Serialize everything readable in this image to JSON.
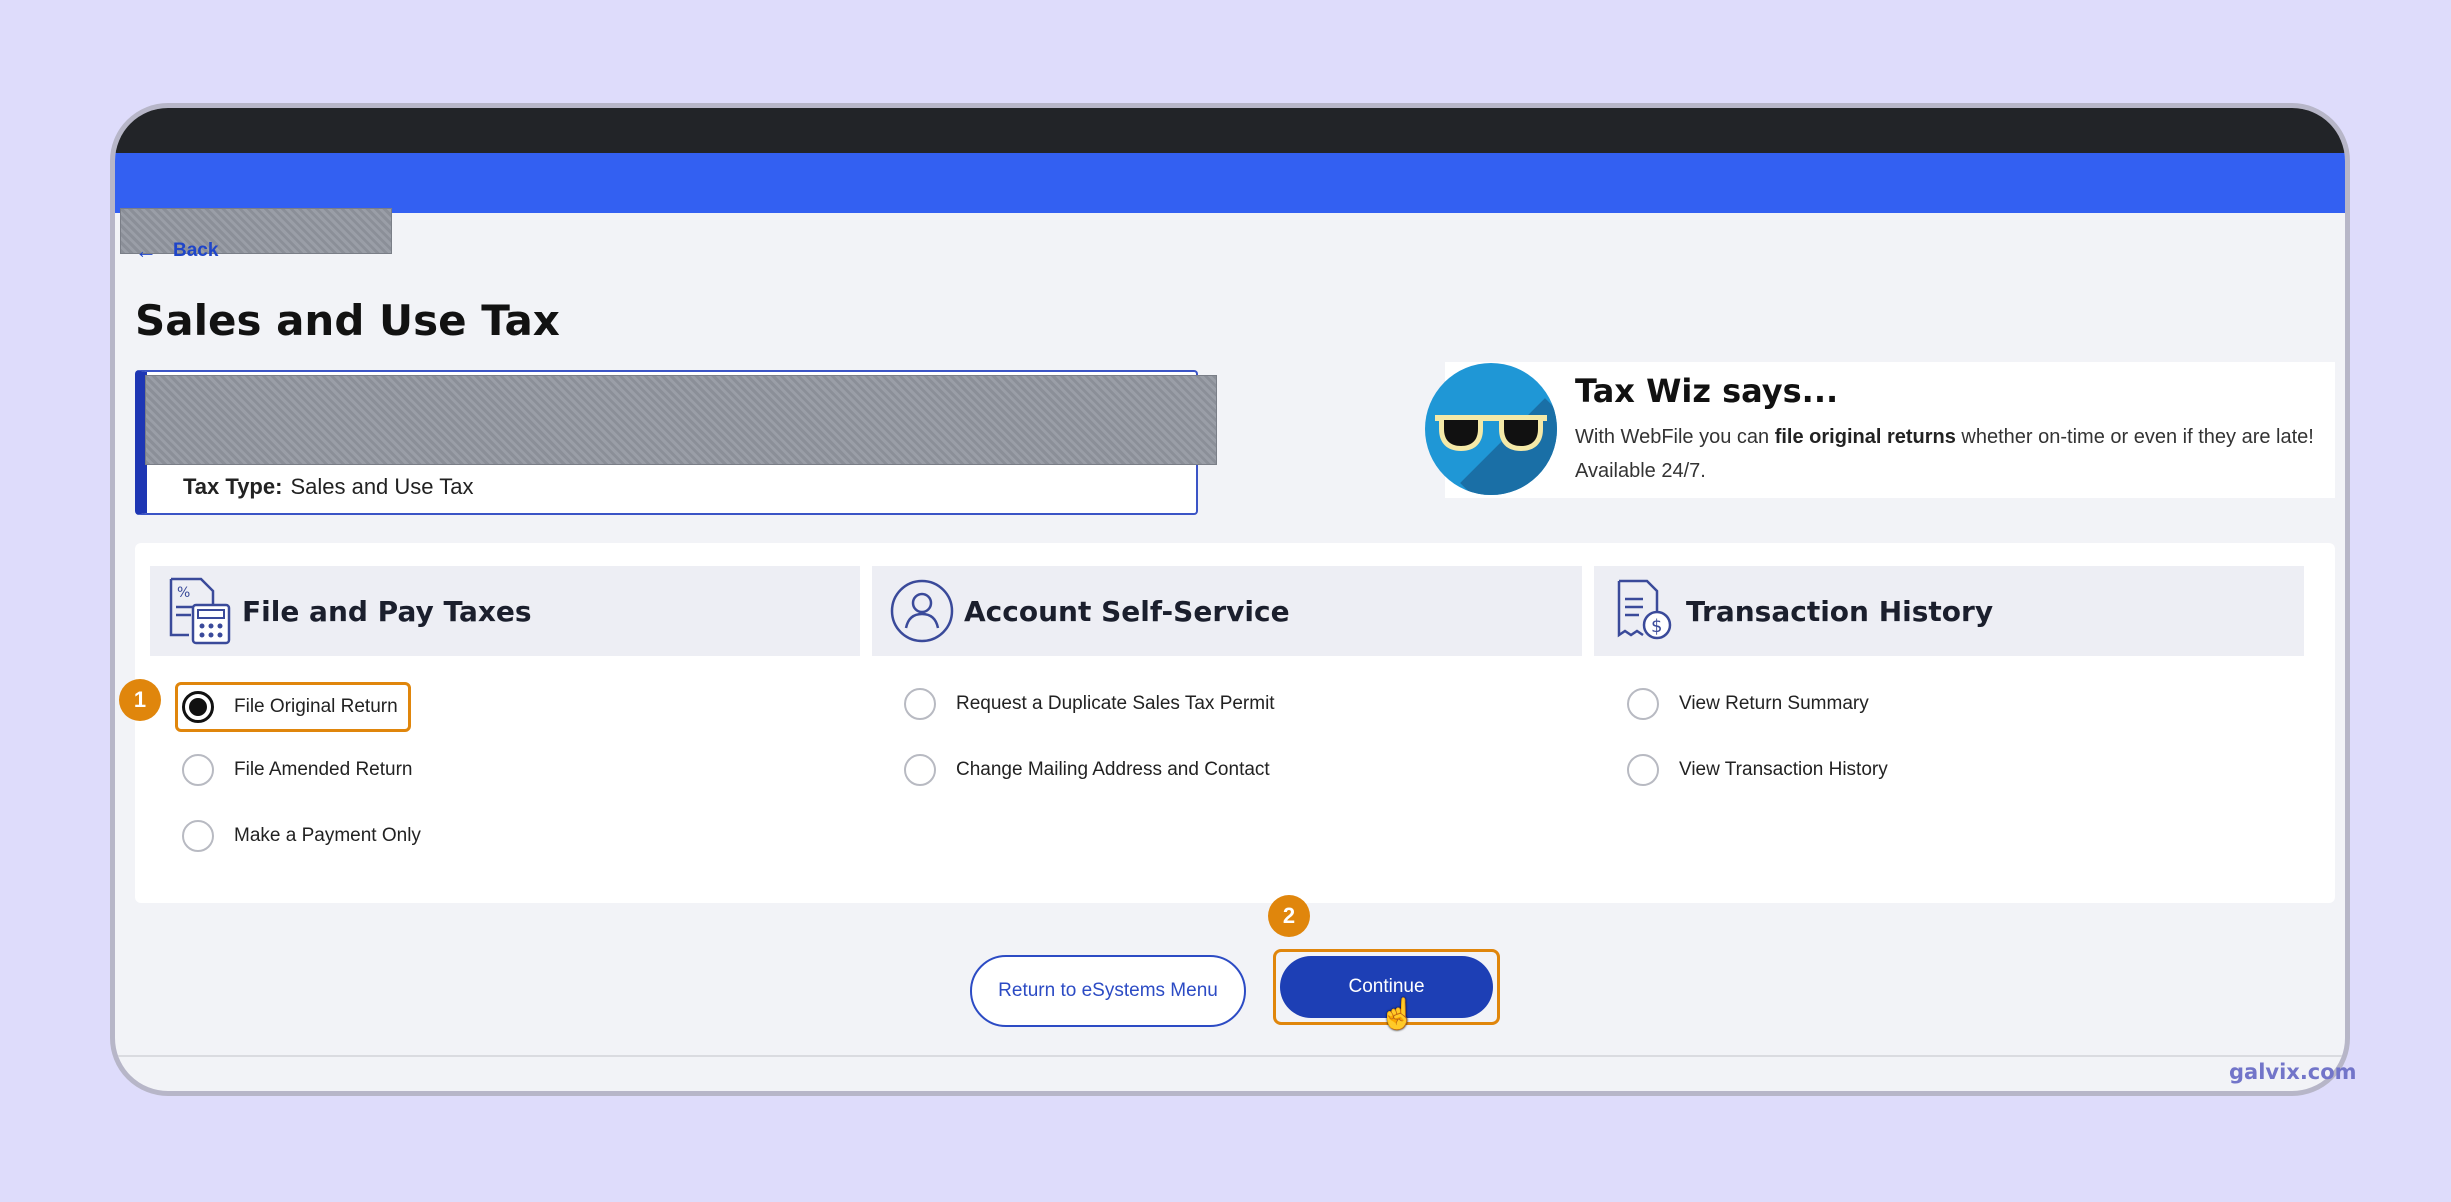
{
  "header": {
    "back_label": "Back"
  },
  "page": {
    "title": "Sales and Use Tax"
  },
  "account": {
    "tax_type_label": "Tax Type:",
    "tax_type_value": "Sales and Use Tax"
  },
  "wiz": {
    "title": "Tax Wiz says...",
    "text_before": "With WebFile you can ",
    "text_bold": "file original returns",
    "text_after": " whether on-time or even if they are late! Available 24/7."
  },
  "columns": [
    {
      "heading": "File and Pay Taxes",
      "icon": "calculator-document-icon",
      "options": [
        "File Original Return",
        "File Amended Return",
        "Make a Payment Only"
      ]
    },
    {
      "heading": "Account Self-Service",
      "icon": "person-icon",
      "options": [
        "Request a Duplicate Sales Tax Permit",
        "Change Mailing Address and Contact"
      ]
    },
    {
      "heading": "Transaction History",
      "icon": "receipt-dollar-icon",
      "options": [
        "View Return Summary",
        "View Transaction History"
      ]
    }
  ],
  "selected_option": "File Original Return",
  "steps": [
    "1",
    "2"
  ],
  "buttons": {
    "return_label": "Return to eSystems Menu",
    "continue_label": "Continue"
  },
  "watermark": "galvix.com",
  "colors": {
    "accent": "#1d3fb5",
    "header_blue": "#3360f2",
    "step_orange": "#e0860c"
  }
}
